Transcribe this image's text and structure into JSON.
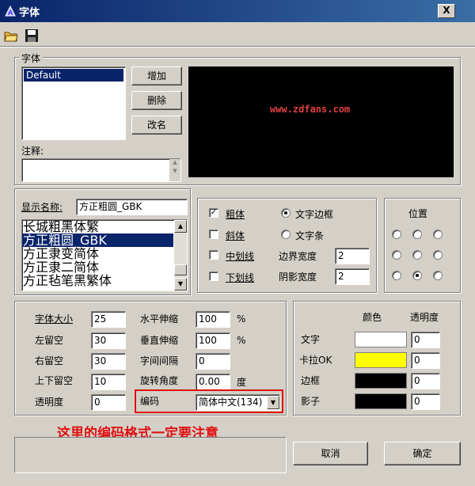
{
  "window": {
    "title": "字体",
    "close_label": "X"
  },
  "font_group": {
    "label": "字体",
    "list_items": [
      "Default"
    ],
    "add_button": "增加",
    "delete_button": "删除",
    "rename_button": "改名",
    "note_label": "注释:",
    "note_value": ""
  },
  "preview": {
    "watermark": "www.zdfans.com"
  },
  "display_name": {
    "label": "显示名称:",
    "value": "方正粗圆_GBK",
    "list_items": [
      "长城粗黑体繁",
      "方正粗圆_GBK",
      "方正隶变简体",
      "方正隶二简体",
      "方正毡笔黑繁体"
    ],
    "selected_index": 1
  },
  "style": {
    "bold_label": "粗体",
    "bold_checked": true,
    "italic_label": "斜体",
    "italic_checked": false,
    "midline_label": "中划线",
    "midline_checked": false,
    "underline_label": "下划线",
    "underline_checked": false,
    "text_border_label": "文字边框",
    "text_strip_label": "文字条",
    "border_width_label": "边界宽度",
    "border_width_value": "2",
    "shadow_width_label": "阴影宽度",
    "shadow_width_value": "2"
  },
  "position": {
    "label": "位置",
    "selected_index": 7
  },
  "metrics": {
    "font_size_label": "字体大小",
    "font_size_value": "25",
    "left_margin_label": "左留空",
    "left_margin_value": "30",
    "right_margin_label": "右留空",
    "right_margin_value": "30",
    "vertical_margin_label": "上下留空",
    "vertical_margin_value": "10",
    "opacity_label": "透明度",
    "opacity_value": "0",
    "hstretch_label": "水平伸缩",
    "hstretch_value": "100",
    "hstretch_unit": "%",
    "vstretch_label": "垂直伸缩",
    "vstretch_value": "100",
    "vstretch_unit": "%",
    "spacing_label": "字间间隔",
    "spacing_value": "0",
    "rotation_label": "旋转角度",
    "rotation_value": "0.00",
    "rotation_unit": "度",
    "encoding_label": "编码",
    "encoding_value": "简体中文(134)"
  },
  "colors": {
    "color_header": "颜色",
    "opacity_header": "透明度",
    "rows": [
      {
        "label": "文字",
        "color": "#ffffff",
        "opacity": "0"
      },
      {
        "label": "卡拉OK",
        "color": "#ffff00",
        "opacity": "0"
      },
      {
        "label": "边框",
        "color": "#000000",
        "opacity": "0"
      },
      {
        "label": "影子",
        "color": "#000000",
        "opacity": "0"
      }
    ]
  },
  "annotation": {
    "text": "这里的编码格式一定要注意",
    "color": "#e01010"
  },
  "footer": {
    "cancel_button": "取消",
    "ok_button": "确定",
    "status_text": ""
  }
}
